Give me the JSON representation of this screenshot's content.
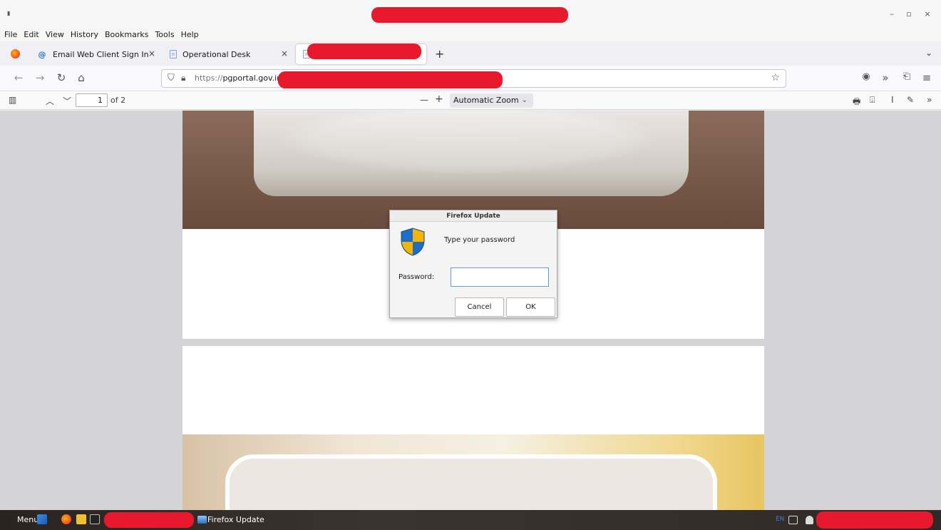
{
  "window": {
    "minimize": "–",
    "maximize": "▫",
    "close": "×"
  },
  "menu": [
    "File",
    "Edit",
    "View",
    "History",
    "Bookmarks",
    "Tools",
    "Help"
  ],
  "tabs": [
    {
      "label": "Email Web Client Sign In",
      "icon": "at-icon",
      "close": "×"
    },
    {
      "label": "Operational Desk",
      "icon": "document-icon",
      "close": "×"
    },
    {
      "label": "",
      "icon": "document-icon",
      "close": "×"
    }
  ],
  "navbar": {
    "url_protocol": "https://",
    "url_host": "pgportal.gov.in"
  },
  "pdf_toolbar": {
    "page_number": "1",
    "page_count": "of 2",
    "zoom": "Automatic Zoom",
    "zoom_out": "—",
    "zoom_in": "+"
  },
  "dialog": {
    "title": "Firefox Update",
    "message": "Type your password",
    "password_label": "Password:",
    "password_value": "",
    "cancel_label": "Cancel",
    "ok_label": "OK"
  },
  "taskbar": {
    "menu_label": "Menu",
    "task_label": "Firefox Update",
    "lang": "EN"
  },
  "colors": {
    "redaction": "#e8192c",
    "accent": "#3a7cd0"
  }
}
